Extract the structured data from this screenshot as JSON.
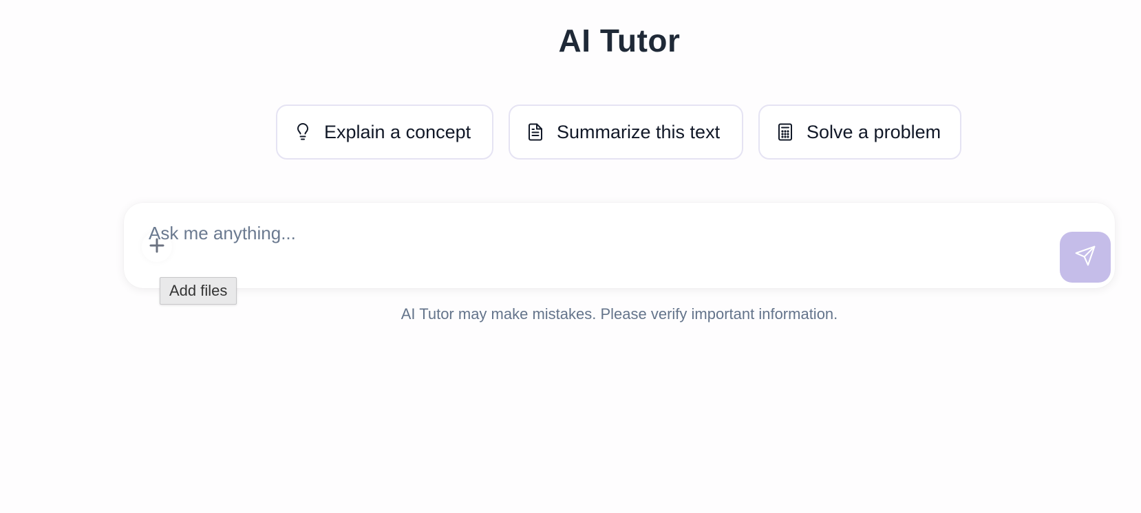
{
  "header": {
    "title": "AI Tutor"
  },
  "suggestions": [
    {
      "label": "Explain a concept",
      "icon": "lightbulb-icon"
    },
    {
      "label": "Summarize this text",
      "icon": "document-icon"
    },
    {
      "label": "Solve a problem",
      "icon": "calculator-icon"
    }
  ],
  "composer": {
    "placeholder": "Ask me anything...",
    "value": "",
    "add_files_icon": "plus-icon",
    "add_files_tooltip": "Add files",
    "send_icon": "send-icon",
    "send_button_color": "#c5bde9"
  },
  "footer": {
    "disclaimer": "AI Tutor may make mistakes. Please verify important information."
  },
  "colors": {
    "background": "#fefdfe",
    "title": "#1f2937",
    "chip_border": "#e5e3f3",
    "muted_text": "#64748b",
    "accent": "#c5bde9"
  }
}
